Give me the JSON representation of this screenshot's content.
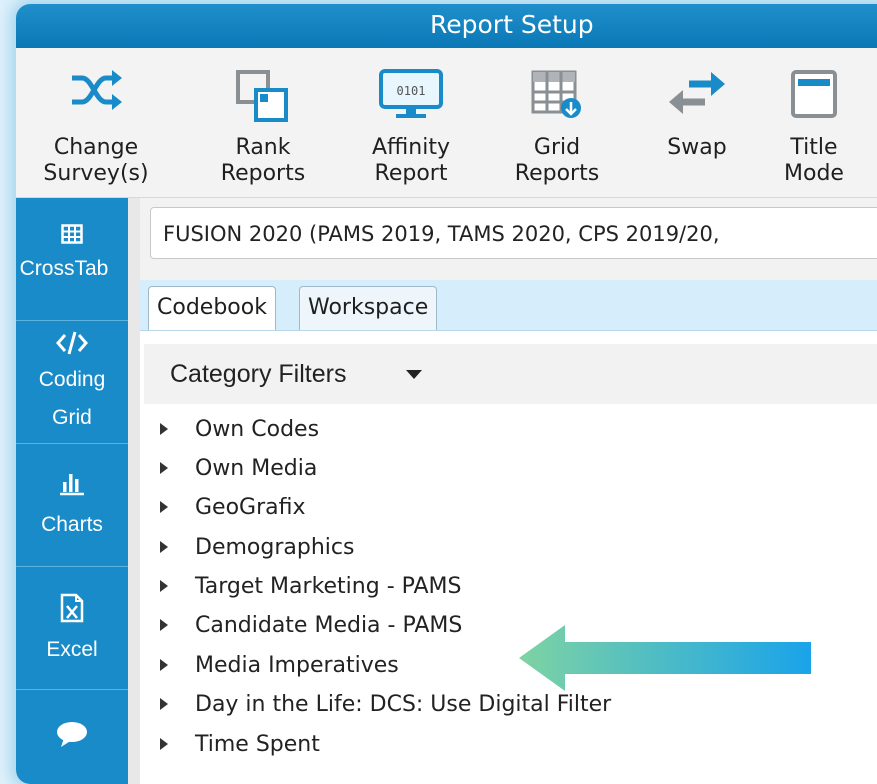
{
  "window": {
    "title": "Report Setup"
  },
  "toolbar": {
    "items": [
      {
        "label": "Change\nSurvey(s)",
        "icon": "shuffle-icon"
      },
      {
        "label": "Rank\nReports",
        "icon": "rank-reports-icon"
      },
      {
        "label": "Affinity\nReport",
        "icon": "affinity-report-icon",
        "icon_text": "0101"
      },
      {
        "label": "Grid\nReports",
        "icon": "grid-reports-icon"
      },
      {
        "label": "Swap",
        "icon": "swap-icon"
      },
      {
        "label": "Title\nMode",
        "icon": "title-mode-icon"
      }
    ]
  },
  "sidebar": {
    "items": [
      {
        "label": "CrossTab",
        "icon": "table-icon"
      },
      {
        "label": "Coding\nGrid",
        "icon": "code-icon"
      },
      {
        "label": "Charts",
        "icon": "bar-chart-icon"
      },
      {
        "label": "Excel",
        "icon": "excel-icon"
      },
      {
        "label": "",
        "icon": "chat-icon"
      }
    ]
  },
  "survey": {
    "value": "FUSION 2020 (PAMS 2019, TAMS 2020, CPS 2019/20,"
  },
  "tabs": [
    {
      "label": "Codebook",
      "active": true
    },
    {
      "label": "Workspace",
      "active": false
    }
  ],
  "filters": {
    "label": "Category Filters"
  },
  "categories": [
    "Own Codes",
    "Own Media",
    "GeoGrafix",
    "Demographics",
    "Target Marketing - PAMS",
    "Candidate Media - PAMS",
    "Media Imperatives",
    "Day in the Life: DCS: Use Digital Filter",
    "Time Spent"
  ],
  "colors": {
    "accent": "#1a8bc9",
    "title_bar": "#0b78b6",
    "arrow_start": "#7ed3a3",
    "arrow_end": "#1aa3ea"
  }
}
